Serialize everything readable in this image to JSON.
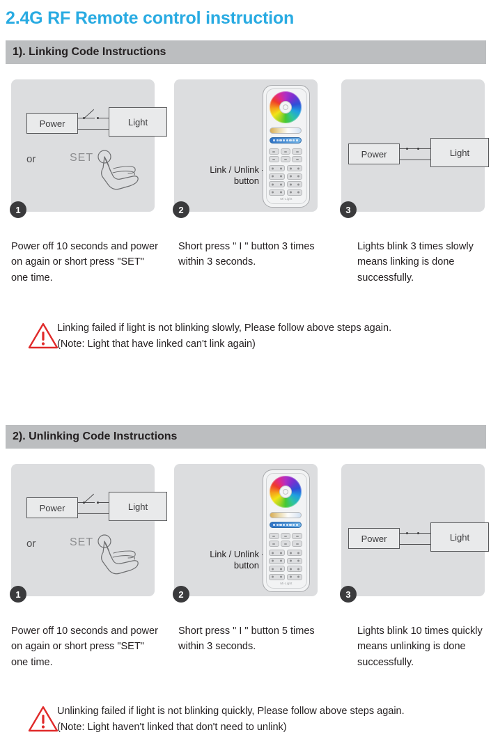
{
  "page": {
    "title": "2.4G RF Remote control instruction",
    "accent_color": "#29abe2",
    "header_bar_color": "#bcbec0",
    "panel_color": "#dcdddf",
    "warning_color": "#e02a2a"
  },
  "sections": [
    {
      "heading": "1). Linking Code Instructions",
      "panels": [
        {
          "badge": "1",
          "type": "wiring",
          "power_label": "Power",
          "light_label": "Light",
          "or_label": "or",
          "set_label": "SET"
        },
        {
          "badge": "2",
          "type": "remote",
          "leader_label_line1": "Link / Unlink",
          "leader_label_line2": "button",
          "remote_brand": "Mi·Light"
        },
        {
          "badge": "3",
          "type": "wiring-connected",
          "power_label": "Power",
          "light_label": "Light"
        }
      ],
      "captions": [
        "Power off 10 seconds and power on again or short press \"SET\" one time.",
        "Short press \" I \" button 3 times within 3 seconds.",
        "Lights blink 3 times slowly means linking is done successfully."
      ],
      "warning": {
        "icon": "warning-triangle-icon",
        "line1": "Linking failed if light is not blinking slowly, Please follow above steps again.",
        "line2": "(Note: Light that have linked can't link again)"
      }
    },
    {
      "heading": "2). Unlinking Code Instructions",
      "panels": [
        {
          "badge": "1",
          "type": "wiring",
          "power_label": "Power",
          "light_label": "Light",
          "or_label": "or",
          "set_label": "SET"
        },
        {
          "badge": "2",
          "type": "remote",
          "leader_label_line1": "Link / Unlink",
          "leader_label_line2": "button",
          "remote_brand": "Mi·Light"
        },
        {
          "badge": "3",
          "type": "wiring-connected",
          "power_label": "Power",
          "light_label": "Light"
        }
      ],
      "captions": [
        "Power off 10 seconds and power on again or short press \"SET\" one time.",
        "Short press \" I \" button 5 times within 3 seconds.",
        "Lights blink 10 times quickly means unlinking is done successfully."
      ],
      "warning": {
        "icon": "warning-triangle-icon",
        "line1": "Unlinking failed if light is not blinking quickly, Please follow above steps again.",
        "line2": "(Note: Light haven't linked that don't need to unlink)"
      }
    }
  ]
}
